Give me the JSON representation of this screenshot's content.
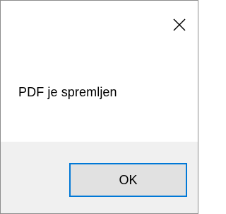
{
  "dialog": {
    "close_icon": "close-icon",
    "message": "PDF je spremljen",
    "ok_label": "OK"
  },
  "colors": {
    "footer_background": "#f0f0f0",
    "button_border": "#0078d7",
    "button_background": "#e1e1e1"
  }
}
